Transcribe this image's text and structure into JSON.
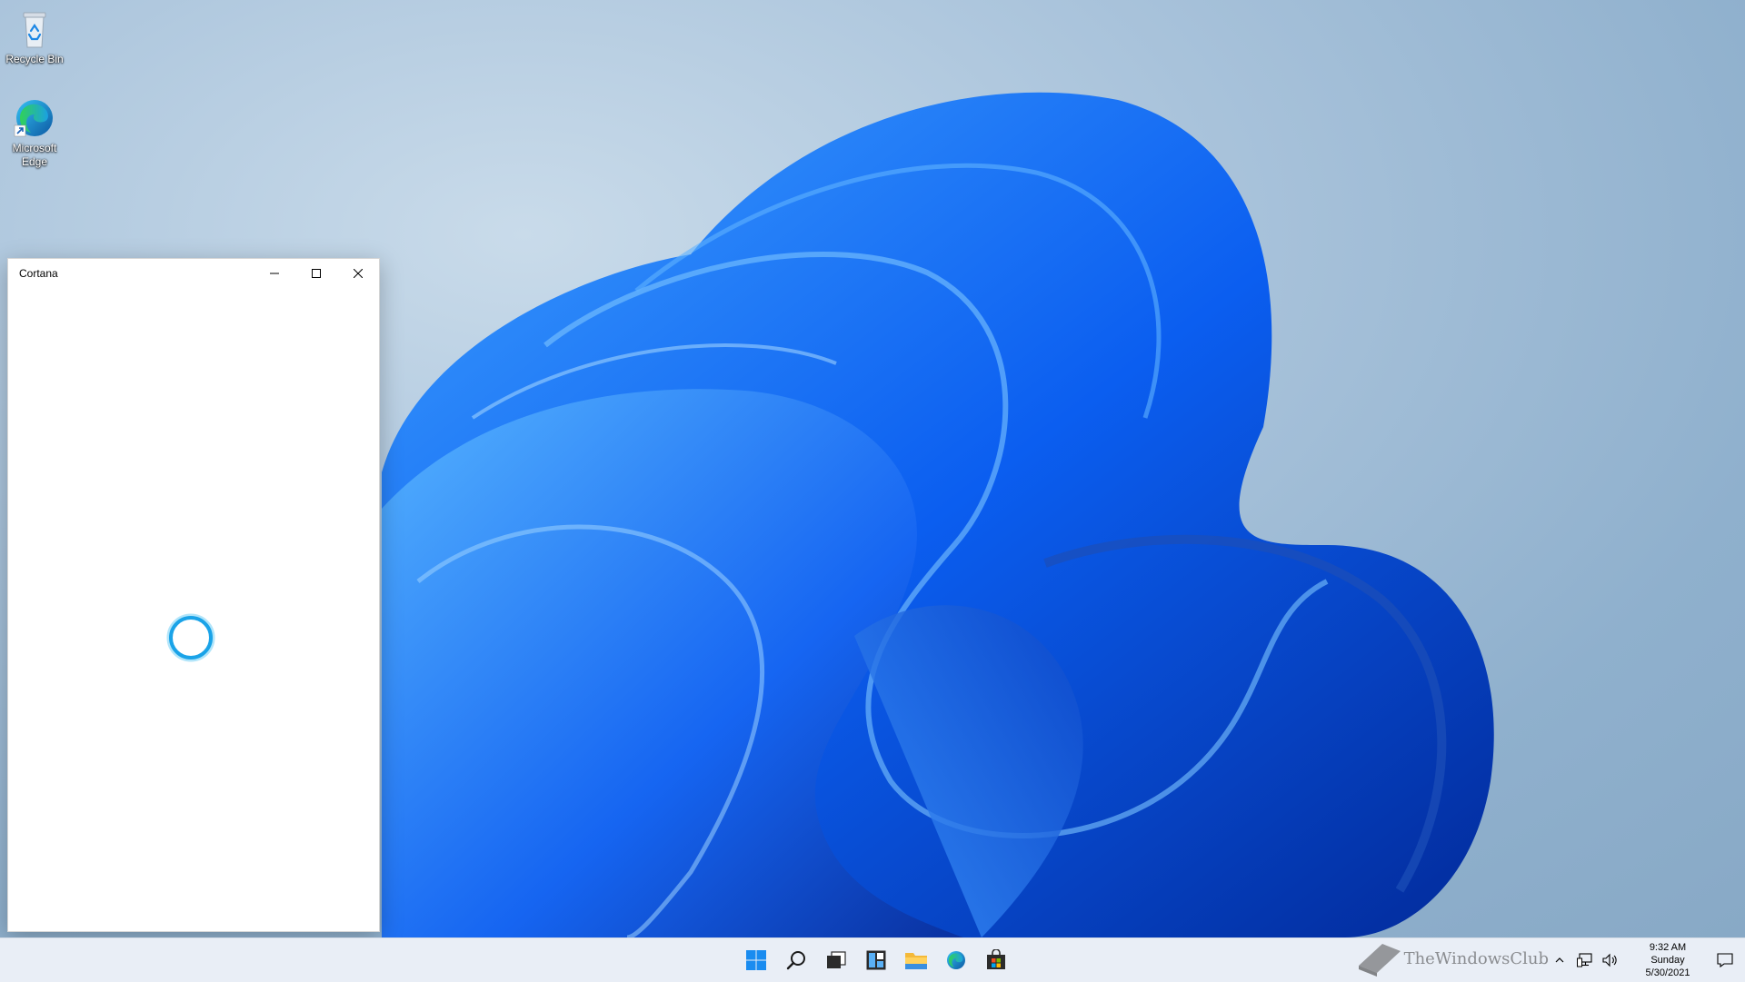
{
  "desktop": {
    "icons": [
      {
        "label": "Recycle Bin",
        "icon": "recycle-bin-icon"
      },
      {
        "label": "Microsoft Edge",
        "icon": "edge-icon"
      }
    ]
  },
  "cortana_window": {
    "title": "Cortana",
    "controls": [
      "minimize",
      "maximize",
      "close"
    ]
  },
  "taskbar": {
    "apps": [
      "start",
      "search",
      "task-view",
      "widgets",
      "file-explorer",
      "edge",
      "store"
    ],
    "tray": {
      "time": "9:32 AM",
      "day": "Sunday",
      "date": "5/30/2021"
    }
  },
  "watermark": {
    "text": "TheWindowsClub"
  },
  "colors": {
    "accent": "#0078d4",
    "cortana_ring": "#1aa3e8",
    "taskbar": "#e9eef6"
  }
}
